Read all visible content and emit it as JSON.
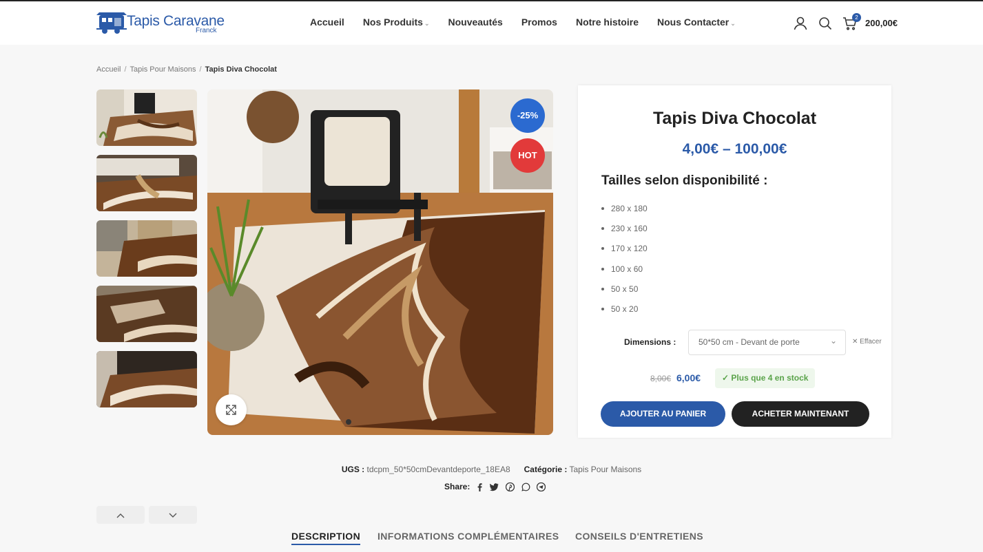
{
  "header": {
    "logo_title": "Tapis Caravane",
    "logo_sub": "Franck",
    "nav": [
      {
        "label": "Accueil",
        "dropdown": false
      },
      {
        "label": "Nos Produits",
        "dropdown": true
      },
      {
        "label": "Nouveautés",
        "dropdown": false
      },
      {
        "label": "Promos",
        "dropdown": false
      },
      {
        "label": "Notre histoire",
        "dropdown": false
      },
      {
        "label": "Nous Contacter",
        "dropdown": true
      }
    ],
    "cart_count": "2",
    "cart_total": "200,00€"
  },
  "breadcrumb": {
    "items": [
      "Accueil",
      "Tapis Pour Maisons"
    ],
    "current": "Tapis Diva Chocolat"
  },
  "gallery": {
    "badge_sale": "-25%",
    "badge_hot": "HOT"
  },
  "product": {
    "title": "Tapis Diva Chocolat",
    "price_range": "4,00€ – 100,00€",
    "sizes_title": "Tailles selon disponibilité :",
    "sizes": [
      "280 x 180",
      "230 x 160",
      "170 x 120",
      "100 x 60",
      "50 x 50",
      "50 x 20"
    ],
    "dimensions_label": "Dimensions :",
    "dimensions_value": "50*50 cm - Devant de porte",
    "clear_label": "Effacer",
    "old_price": "8,00€",
    "new_price": "6,00€",
    "stock": "Plus que 4 en stock",
    "add_to_cart": "AJOUTER AU PANIER",
    "buy_now": "ACHETER MAINTENANT"
  },
  "meta": {
    "sku_label": "UGS :",
    "sku": "tdcpm_50*50cmDevantdeporte_18EA8",
    "category_label": "Catégorie :",
    "category": "Tapis Pour Maisons",
    "share_label": "Share:"
  },
  "tabs": [
    "DESCRIPTION",
    "INFORMATIONS COMPLÉMENTAIRES",
    "CONSEILS D'ENTRETIENS"
  ],
  "colors": {
    "brand": "#2b5aa8",
    "sale_badge": "#2b6ad0",
    "hot_badge": "#e23a3a",
    "stock": "#5aa34a"
  }
}
